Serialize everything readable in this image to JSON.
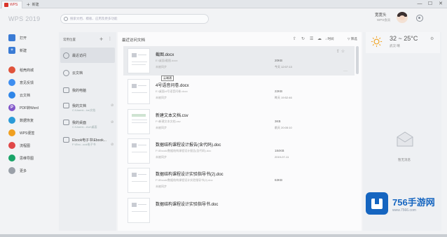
{
  "titlebar": {
    "app_tab": "WPS",
    "new_tab": "新建",
    "minimize": "—",
    "maximize": "☐",
    "close": "✕"
  },
  "header": {
    "logo": "WPS 2019",
    "search_placeholder": "搜索文档、模板、应用及更多功能",
    "user_name": "宽宽头",
    "user_sub": "WPS会员"
  },
  "sidebar": {
    "items": [
      {
        "label": "打开",
        "icon": "folder-icon",
        "color": "#3a7bd5"
      },
      {
        "label": "新建",
        "icon": "plus-icon",
        "color": "#3a7bd5"
      },
      {
        "label": "稻壳商城",
        "icon": "mall-icon",
        "color": "#e0533b"
      },
      {
        "label": "意见反馈",
        "icon": "feedback-icon",
        "color": "#3e8ef0"
      },
      {
        "label": "云文档",
        "icon": "cloud-icon",
        "color": "#2f86e8"
      },
      {
        "label": "PDF转Word",
        "icon": "pdf-icon",
        "color": "#8156c9"
      },
      {
        "label": "数据恢复",
        "icon": "recover-icon",
        "color": "#2b9bd8"
      },
      {
        "label": "WPS便签",
        "icon": "note-icon",
        "color": "#f0a020"
      },
      {
        "label": "流程图",
        "icon": "flowchart-icon",
        "color": "#e04848"
      },
      {
        "label": "思维导图",
        "icon": "mindmap-icon",
        "color": "#1aa468"
      },
      {
        "label": "更多",
        "icon": "grid-icon",
        "color": "#9aa0a8"
      }
    ]
  },
  "locations": {
    "title": "常用位置",
    "add": "+",
    "more": "⋮",
    "items": [
      {
        "label": "最近访问",
        "sub": ""
      },
      {
        "label": "云文档",
        "sub": ""
      },
      {
        "label": "我的电脑",
        "sub": ""
      },
      {
        "label": "我的文档",
        "sub": "C:\\Users\\...ive文档"
      },
      {
        "label": "我的桌面",
        "sub": "C:\\Users\\...rive\\桌面"
      },
      {
        "label": "Ebook电子书\\Ebook...",
        "sub": "F:\\Ebo...ook电子书"
      }
    ]
  },
  "file_list": {
    "title": "最近访问文档",
    "sort_label": "时间",
    "filter_label": "筛选",
    "tooltip": "云端通",
    "files": [
      {
        "name": "截图.docx",
        "path": "E:\\桌面\\截图.docx",
        "owner": "未被同步",
        "size": "20KB",
        "time": "今天 12:07:13"
      },
      {
        "name": "4号语音问卷.docx",
        "path": "E:\\桌面\\4号语音问卷.docx",
        "owner": "未被同步",
        "size": "22KB",
        "time": "昨天 19:52:46"
      },
      {
        "name": "新建文本文档.csv",
        "path": "F:\\新建文本文档.csv",
        "owner": "未被同步",
        "size": "3KB",
        "time": "前天 20:05:10"
      },
      {
        "name": "数据结构课程设计报告(含代码).doc",
        "path": "F:\\Ebook\\数据结构课程设计报告(含代码).doc",
        "owner": "未被同步",
        "size": "184KB",
        "time": "2019-07-11"
      },
      {
        "name": "数据结构课程设计实验指导书(2).doc",
        "path": "F:\\Ebook\\数据结构课程设计实验指导书(2).doc",
        "owner": "未被同步",
        "size": "63KB",
        "time": ""
      },
      {
        "name": "数据结构课程设计实验指导书.doc",
        "path": "",
        "owner": "",
        "size": "",
        "time": ""
      }
    ]
  },
  "weather": {
    "temp": "32 ~ 25°C",
    "city": "武汉 晴"
  },
  "empty_panel": {
    "text": "暂无消息"
  },
  "watermark": {
    "brand": "756手游网",
    "url": "www.7566.com"
  }
}
